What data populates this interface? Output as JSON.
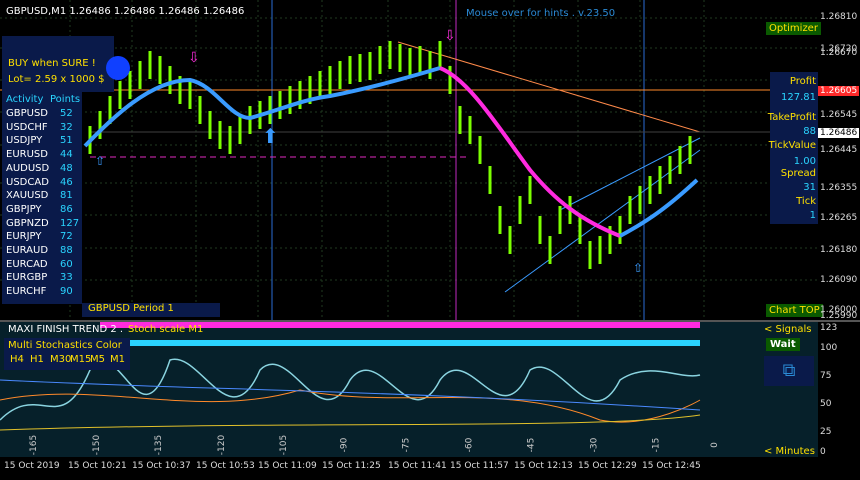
{
  "title": "GBPUSD,M1  1.26486 1.26486 1.26486 1.26486",
  "hint": "Mouse over for hints . v.23.50",
  "buy_box": {
    "line1": "BUY when SURE !",
    "line2": "Lot= 2.59 x 1000 $"
  },
  "activity": {
    "header_left": "Activity",
    "header_right": "Points",
    "rows": [
      {
        "sym": "GBPUSD",
        "pts": "52"
      },
      {
        "sym": "USDCHF",
        "pts": "32"
      },
      {
        "sym": "USDJPY",
        "pts": "51"
      },
      {
        "sym": "EURUSD",
        "pts": "44"
      },
      {
        "sym": "AUDUSD",
        "pts": "48"
      },
      {
        "sym": "USDCAD",
        "pts": "46"
      },
      {
        "sym": "XAUUSD",
        "pts": "81"
      },
      {
        "sym": "GBPJPY",
        "pts": "86"
      },
      {
        "sym": "GBPNZD",
        "pts": "127"
      },
      {
        "sym": "EURJPY",
        "pts": "72"
      },
      {
        "sym": "EURAUD",
        "pts": "88"
      },
      {
        "sym": "EURCAD",
        "pts": "60"
      },
      {
        "sym": "EURGBP",
        "pts": "33"
      },
      {
        "sym": "EURCHF",
        "pts": "90"
      }
    ]
  },
  "period_label": "GBPUSD Period 1",
  "optimizer": "Optimizer",
  "chart_top": "Chart TOP",
  "stats": {
    "profit_label": "Profit",
    "profit": "127.81",
    "tp_label": "TakeProfit",
    "tp": "88",
    "tick_value_label": "TickValue",
    "tick_value": "1.00",
    "spread_label": "Spread",
    "spread": "31",
    "tick_label": "Tick",
    "tick": "1"
  },
  "price_axis": [
    "1.26810",
    "1.26720",
    "1.26670",
    "1.26605",
    "1.26545",
    "1.26486",
    "1.26445",
    "1.26355",
    "1.26265",
    "1.26180",
    "1.26090",
    "1.26000",
    "1.25990"
  ],
  "price_marks": {
    "red": "1.26605",
    "current": "1.26486"
  },
  "sub": {
    "title": "MAXI FINISH TREND 2 .",
    "scale": "Stoch scale M1",
    "multi": "Multi Stochastics Color",
    "tfs": [
      "H4",
      "H1",
      "M30",
      "M15",
      "M5",
      "M1"
    ],
    "signals": "< Signals",
    "wait": "Wait",
    "minutes": "< Minutes"
  },
  "sub_axis": [
    "123",
    "100",
    "75",
    "50",
    "25",
    "0"
  ],
  "sub_bottom_nums": [
    "-165",
    "-150",
    "-135",
    "-120",
    "-105",
    "-90",
    "-75",
    "-60",
    "-45",
    "-30",
    "-15",
    "0"
  ],
  "time_axis": [
    "15 Oct 2019",
    "15 Oct 10:21",
    "15 Oct 10:37",
    "15 Oct 10:53",
    "15 Oct 11:09",
    "15 Oct 11:25",
    "15 Oct 11:41",
    "15 Oct 11:57",
    "15 Oct 12:13",
    "15 Oct 12:29",
    "15 Oct 12:45"
  ],
  "colors": {
    "bg": "#000000",
    "grid": "#2a3a2a",
    "up": "#7cff00",
    "down": "#7cff00",
    "ma_blue": "#3a9bff",
    "ma_magenta": "#ff2adf",
    "panel": "#0a1a4a",
    "accent": "#2ad4ff"
  }
}
